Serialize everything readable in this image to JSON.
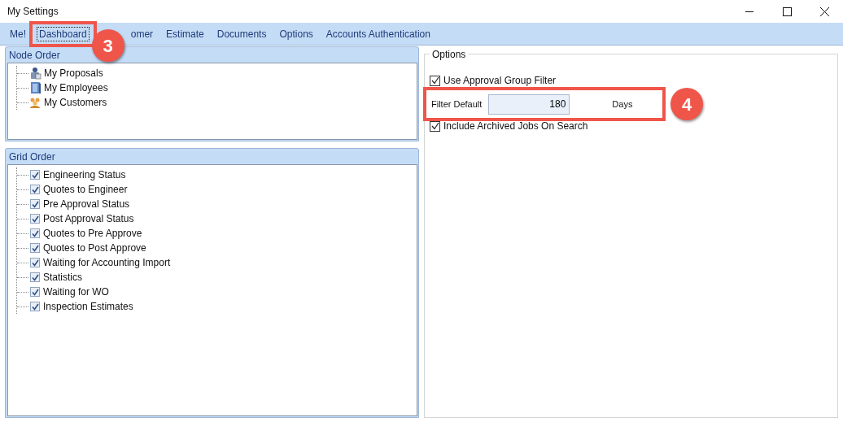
{
  "window": {
    "title": "My Settings"
  },
  "tabs": [
    {
      "label": "Me!",
      "selected": false
    },
    {
      "label": "Dashboard",
      "selected": true
    },
    {
      "label": "omer",
      "selected": false
    },
    {
      "label": "Estimate",
      "selected": false
    },
    {
      "label": "Documents",
      "selected": false
    },
    {
      "label": "Options",
      "selected": false
    },
    {
      "label": "Accounts Authentication",
      "selected": false
    }
  ],
  "node_order": {
    "title": "Node Order",
    "items": [
      {
        "label": "My Proposals",
        "kind": "proposals"
      },
      {
        "label": "My Employees",
        "kind": "employees"
      },
      {
        "label": "My Customers",
        "kind": "customers"
      }
    ]
  },
  "grid_order": {
    "title": "Grid Order",
    "items": [
      {
        "label": "Engineering Status",
        "checked": true
      },
      {
        "label": "Quotes to Engineer",
        "checked": true
      },
      {
        "label": "Pre Approval Status",
        "checked": true
      },
      {
        "label": "Post Approval Status",
        "checked": true
      },
      {
        "label": "Quotes to Pre Approve",
        "checked": true
      },
      {
        "label": "Quotes to Post Approve",
        "checked": true
      },
      {
        "label": "Waiting for Accounting Import",
        "checked": true
      },
      {
        "label": "Statistics",
        "checked": true
      },
      {
        "label": "Waiting for WO",
        "checked": true
      },
      {
        "label": "Inspection Estimates",
        "checked": true
      }
    ]
  },
  "options": {
    "title": "Options",
    "use_approval_group_filter": {
      "label": "Use Approval Group Filter",
      "checked": true
    },
    "filter_default": {
      "label": "Filter Default",
      "value": "180",
      "unit": "Days"
    },
    "include_archived": {
      "label": "Include Archived Jobs On Search",
      "checked": true
    }
  },
  "annotations": [
    {
      "number": "3"
    },
    {
      "number": "4"
    }
  ]
}
